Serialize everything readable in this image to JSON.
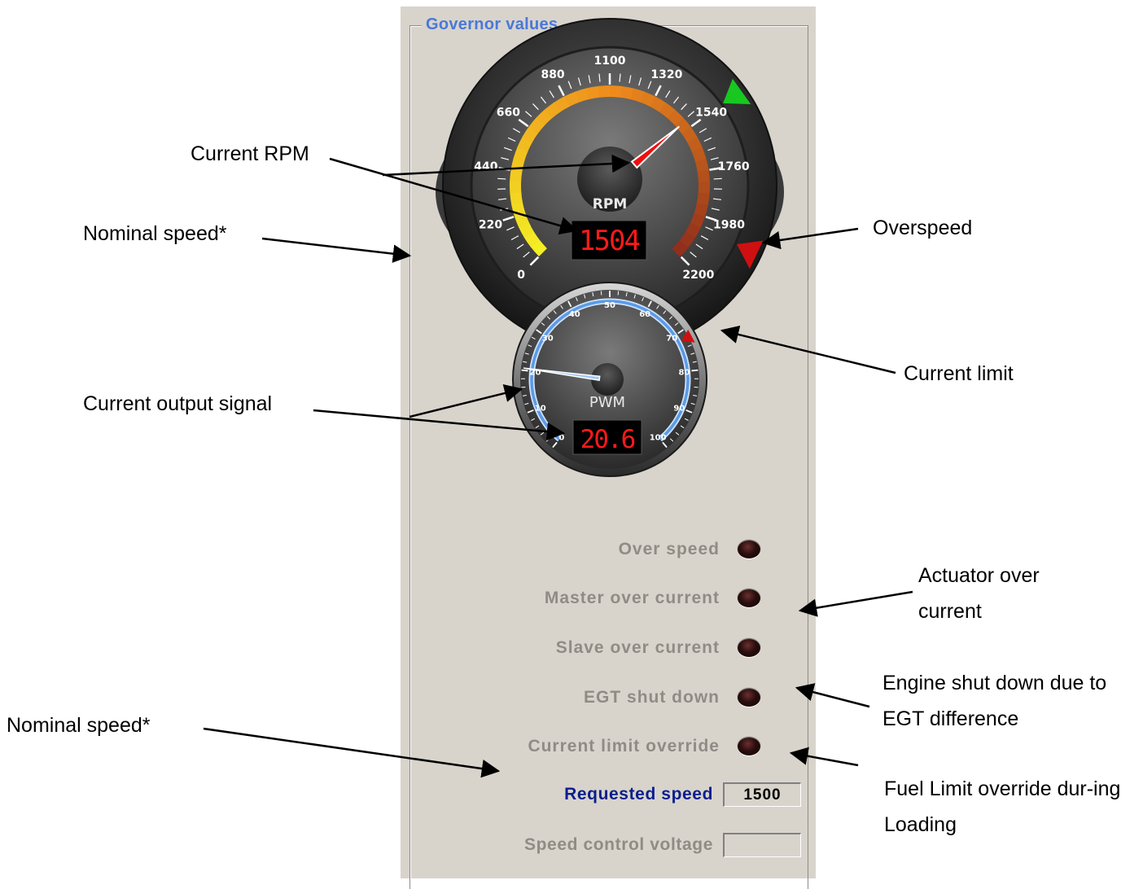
{
  "group_title": "Governor values",
  "rpm_gauge": {
    "label": "RPM",
    "value": 1504,
    "display": "1504",
    "min": 0,
    "max": 2200,
    "tick_labels": [
      "0",
      "220",
      "440",
      "660",
      "880",
      "1100",
      "1320",
      "1540",
      "1760",
      "1980",
      "2200"
    ],
    "nominal_marker": 1540,
    "overspeed_marker": 2035,
    "colors": {
      "arc_start": "#f4ee24",
      "arc_mid": "#ee8a1c",
      "arc_end": "#8c2a1c",
      "needle": "#ee1010",
      "nominal": "#18c820",
      "overspeed": "#d01010",
      "display_text": "#ff1a1a"
    }
  },
  "pwm_gauge": {
    "label": "PWM",
    "value": 20.6,
    "display": "20.6",
    "min": 0,
    "max": 100,
    "tick_labels": [
      "0",
      "10",
      "20",
      "30",
      "40",
      "50",
      "60",
      "70",
      "80",
      "90",
      "100"
    ],
    "limit_marker": 72,
    "colors": {
      "arc": "#5a9ae8",
      "needle": "#a6c8f2",
      "limit": "#d01010",
      "display_text": "#ff1a1a"
    }
  },
  "status_indicators": [
    {
      "label": "Over speed",
      "on": false
    },
    {
      "label": "Master over current",
      "on": false
    },
    {
      "label": "Slave over current",
      "on": false
    },
    {
      "label": "EGT shut down",
      "on": false
    },
    {
      "label": "Current limit override",
      "on": false
    }
  ],
  "requested_speed": {
    "label": "Requested speed",
    "value": "1500",
    "label_color": "#0a1e8c"
  },
  "speed_control_voltage": {
    "label": "Speed control voltage",
    "value": ""
  },
  "annotations": {
    "current_rpm": "Current RPM",
    "nominal_speed_top": "Nominal speed*",
    "overspeed": "Overspeed",
    "current_limit": "Current limit",
    "current_output_signal": "Current output signal",
    "actuator_over_current": "Actuator over current",
    "egt_shutdown": "Engine shut down due to EGT difference",
    "nominal_speed_bottom": "Nominal speed*",
    "fuel_limit_override": "Fuel Limit override dur-ing Loading"
  }
}
